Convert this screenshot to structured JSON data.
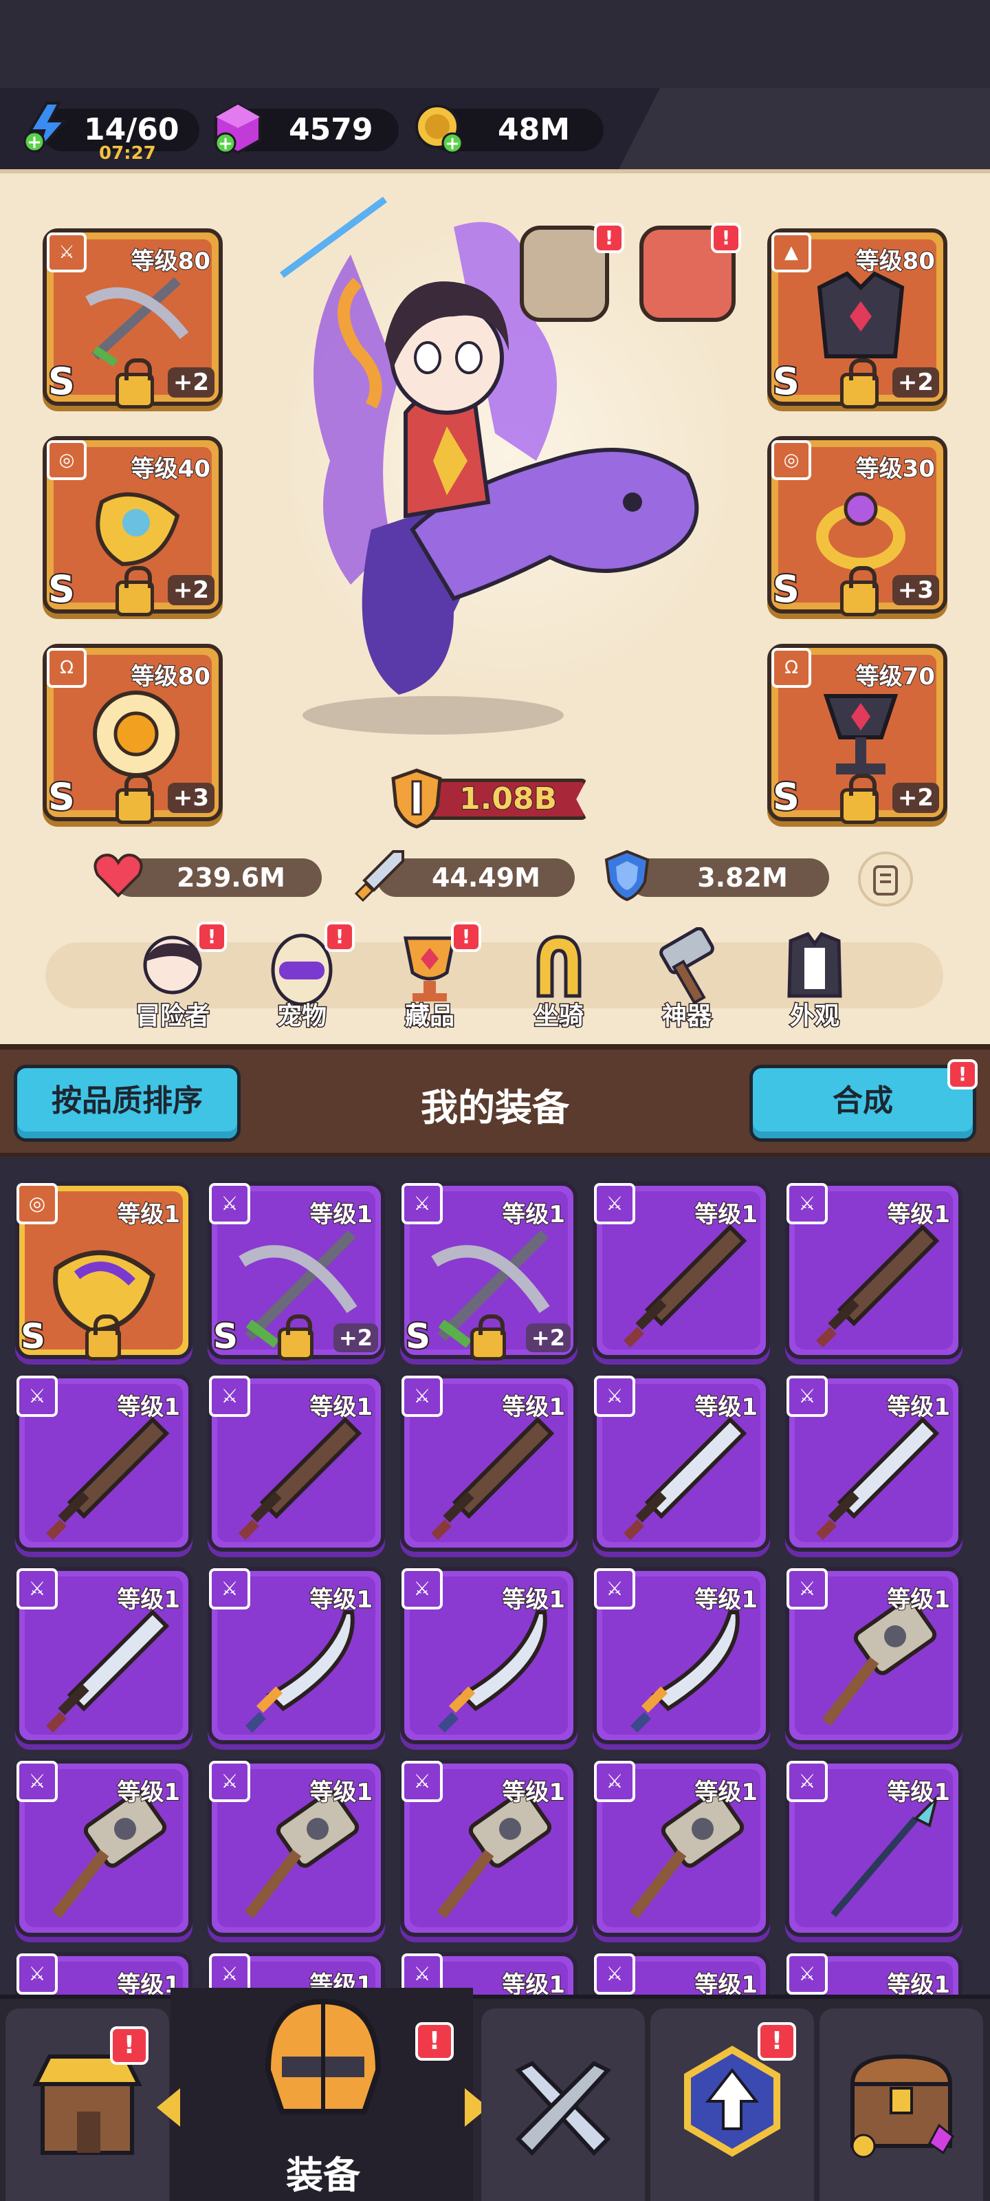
{
  "resources": {
    "energy": {
      "value": "14/60",
      "timer": "07:27",
      "icon": "lightning-icon"
    },
    "gems": {
      "value": "4579",
      "icon": "gem-icon"
    },
    "gold": {
      "value": "48M",
      "icon": "coin-icon"
    }
  },
  "equipment_slots": {
    "left": [
      {
        "level": "等级80",
        "rarity": "S",
        "plus": "+2",
        "item": "crossbow"
      },
      {
        "level": "等级40",
        "rarity": "S",
        "plus": "+2",
        "item": "bracer"
      },
      {
        "level": "等级80",
        "rarity": "S",
        "plus": "+3",
        "item": "amulet"
      }
    ],
    "right": [
      {
        "level": "等级80",
        "rarity": "S",
        "plus": "+2",
        "item": "armor"
      },
      {
        "level": "等级30",
        "rarity": "S",
        "plus": "+3",
        "item": "ring"
      },
      {
        "level": "等级70",
        "rarity": "S",
        "plus": "+2",
        "item": "chalice"
      }
    ]
  },
  "power": "1.08B",
  "stats": {
    "hp": "239.6M",
    "attack": "44.49M",
    "defense": "3.82M"
  },
  "nav": [
    {
      "label": "冒险者",
      "badge": "!"
    },
    {
      "label": "宠物",
      "badge": "!"
    },
    {
      "label": "藏品",
      "badge": "!"
    },
    {
      "label": "坐骑",
      "badge": ""
    },
    {
      "label": "神器",
      "badge": ""
    },
    {
      "label": "外观",
      "badge": ""
    }
  ],
  "section": {
    "sort_button": "按品质排序",
    "title": "我的装备",
    "merge_button": "合成",
    "merge_badge": "!"
  },
  "inventory": [
    {
      "level": "等级1",
      "type": "bracer",
      "gold": true,
      "rarity": "S",
      "plus": ""
    },
    {
      "level": "等级1",
      "type": "crossbow",
      "gold": false,
      "rarity": "S",
      "plus": "+2"
    },
    {
      "level": "等级1",
      "type": "crossbow",
      "gold": false,
      "rarity": "S",
      "plus": "+2"
    },
    {
      "level": "等级1",
      "type": "wood-sword",
      "gold": false,
      "rarity": "",
      "plus": ""
    },
    {
      "level": "等级1",
      "type": "wood-sword",
      "gold": false,
      "rarity": "",
      "plus": ""
    },
    {
      "level": "等级1",
      "type": "wood-sword",
      "gold": false,
      "rarity": "",
      "plus": ""
    },
    {
      "level": "等级1",
      "type": "wood-sword",
      "gold": false,
      "rarity": "",
      "plus": ""
    },
    {
      "level": "等级1",
      "type": "wood-sword",
      "gold": false,
      "rarity": "",
      "plus": ""
    },
    {
      "level": "等级1",
      "type": "steel-sword",
      "gold": false,
      "rarity": "",
      "plus": ""
    },
    {
      "level": "等级1",
      "type": "steel-sword",
      "gold": false,
      "rarity": "",
      "plus": ""
    },
    {
      "level": "等级1",
      "type": "steel-sword",
      "gold": false,
      "rarity": "",
      "plus": ""
    },
    {
      "level": "等级1",
      "type": "scimitar",
      "gold": false,
      "rarity": "",
      "plus": ""
    },
    {
      "level": "等级1",
      "type": "scimitar",
      "gold": false,
      "rarity": "",
      "plus": ""
    },
    {
      "level": "等级1",
      "type": "scimitar",
      "gold": false,
      "rarity": "",
      "plus": ""
    },
    {
      "level": "等级1",
      "type": "hammer",
      "gold": false,
      "rarity": "",
      "plus": ""
    },
    {
      "level": "等级1",
      "type": "hammer",
      "gold": false,
      "rarity": "",
      "plus": ""
    },
    {
      "level": "等级1",
      "type": "hammer",
      "gold": false,
      "rarity": "",
      "plus": ""
    },
    {
      "level": "等级1",
      "type": "hammer",
      "gold": false,
      "rarity": "",
      "plus": ""
    },
    {
      "level": "等级1",
      "type": "hammer",
      "gold": false,
      "rarity": "",
      "plus": ""
    },
    {
      "level": "等级1",
      "type": "spear",
      "gold": false,
      "rarity": "",
      "plus": ""
    },
    {
      "level": "等级1",
      "type": "sword",
      "gold": false,
      "rarity": "",
      "plus": ""
    },
    {
      "level": "等级1",
      "type": "sword",
      "gold": false,
      "rarity": "",
      "plus": ""
    },
    {
      "level": "等级1",
      "type": "sword",
      "gold": false,
      "rarity": "",
      "plus": ""
    },
    {
      "level": "等级1",
      "type": "sword",
      "gold": false,
      "rarity": "",
      "plus": ""
    },
    {
      "level": "等级1",
      "type": "sword",
      "gold": false,
      "rarity": "",
      "plus": ""
    }
  ],
  "bottom_nav": {
    "active_label": "装备",
    "shop_badge": "!",
    "equip_badge": "!",
    "upgrade_badge": "!"
  },
  "colors": {
    "purple_tile": "#9a4ae0",
    "gold_tile": "#f2c23e",
    "accent_blue": "#3fc4e6",
    "badge_red": "#f03a4a"
  }
}
